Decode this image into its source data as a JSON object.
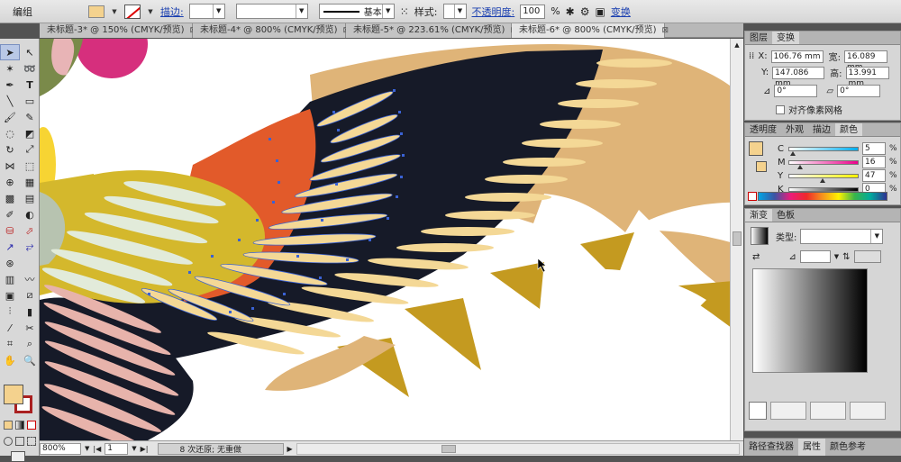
{
  "control_bar": {
    "selection_label": "编组",
    "stroke_label": "描边:",
    "stroke_profile_value": "基本",
    "style_label": "样式:",
    "opacity_label": "不透明度:",
    "opacity_value": "100",
    "opacity_unit": "%",
    "transform_label": "变换"
  },
  "doc_tabs": [
    {
      "label": "未标题-3* @ 150% (CMYK/预览)"
    },
    {
      "label": "未标题-4* @ 800% (CMYK/预览)"
    },
    {
      "label": "未标题-5* @ 223.61% (CMYK/预览)"
    },
    {
      "label": "未标题-6* @ 800% (CMYK/预览)"
    }
  ],
  "status_bar": {
    "zoom": "800%",
    "artboard": "1",
    "status_text": "8 次还原; 无重做"
  },
  "transform_panel": {
    "tab_layers": "图层",
    "tab_transform": "变换",
    "x_label": "X:",
    "x_value": "106.76 mm",
    "y_label": "Y:",
    "y_value": "147.086 mm",
    "w_label": "宽:",
    "w_value": "16.089 mm",
    "h_label": "高:",
    "h_value": "13.991 mm",
    "angle_value": "0°",
    "shear_value": "0°",
    "align_pixel_label": "对齐像素网格"
  },
  "color_panel": {
    "tab_transparency": "透明度",
    "tab_appearance": "外观",
    "tab_stroke": "描边",
    "tab_color": "颜色",
    "channels": [
      {
        "label": "C",
        "value": "5",
        "unit": "%",
        "fill": 0.05
      },
      {
        "label": "M",
        "value": "16",
        "unit": "%",
        "fill": 0.16
      },
      {
        "label": "Y",
        "value": "47",
        "unit": "%",
        "fill": 0.47
      },
      {
        "label": "K",
        "value": "0",
        "unit": "%",
        "fill": 0.0
      }
    ],
    "current_color": "#f4d28e"
  },
  "gradient_panel": {
    "tab_gradient": "渐变",
    "tab_swatches": "色板",
    "type_label": "类型:"
  },
  "bottom_tabs": {
    "pathfinder": "路径查找器",
    "attributes": "属性",
    "color_guide": "颜色参考"
  },
  "colors": {
    "dark_navy": "#161a28",
    "tan": "#dfb478",
    "gold": "#c49a20",
    "orange_red": "#e25a2a",
    "mustard": "#d4b82c",
    "feather_light": "#f4d896",
    "mint": "#e2ebda",
    "pink": "#e7b3ab",
    "magenta": "#d62f7d",
    "anchor_blue": "#3a62d4"
  }
}
